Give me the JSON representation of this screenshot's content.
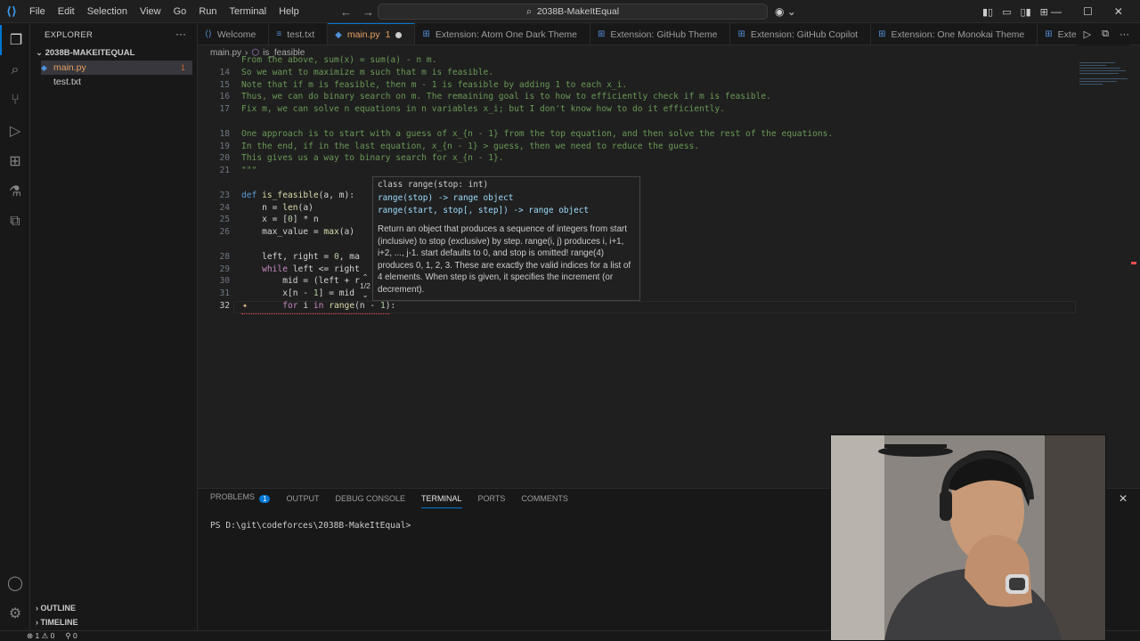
{
  "titlebar": {
    "menu": [
      "File",
      "Edit",
      "Selection",
      "View",
      "Go",
      "Run",
      "Terminal",
      "Help"
    ],
    "search_text": "2038B-MakeItEqual"
  },
  "sidebar": {
    "title": "EXPLORER",
    "folder": "2038B-MAKEITEQUAL",
    "files": [
      {
        "name": "main.py",
        "count": "1"
      },
      {
        "name": "test.txt",
        "count": ""
      }
    ],
    "outline": "OUTLINE",
    "timeline": "TIMELINE"
  },
  "tabs": [
    {
      "label": "Welcome",
      "icon": "vscode-icon"
    },
    {
      "label": "test.txt",
      "icon": "file-icon"
    },
    {
      "label": "main.py",
      "count": "1",
      "icon": "python-icon"
    },
    {
      "label": "Extension: Atom One Dark Theme",
      "icon": "extension-icon"
    },
    {
      "label": "Extension: GitHub Theme",
      "icon": "extension-icon"
    },
    {
      "label": "Extension: GitHub Copilot",
      "icon": "extension-icon"
    },
    {
      "label": "Extension: One Monokai Theme",
      "icon": "extension-icon"
    },
    {
      "label": "Extensio",
      "icon": "extension-icon"
    }
  ],
  "breadcrumb": {
    "file": "main.py",
    "symbol": "is_feasible"
  },
  "editor": {
    "line_numbers": [
      "",
      "14",
      "15",
      "16",
      "17",
      "",
      "18",
      "19",
      "20",
      "21",
      "",
      "23",
      "24",
      "25",
      "26",
      "",
      "28",
      "29",
      "30",
      "31",
      "32"
    ],
    "current_line": "32",
    "lines": [
      "From the above, sum(x) = sum(a) - n m.",
      "So we want to maximize m such that m is feasible.",
      "Note that if m is feasible, then m - 1 is feasible by adding 1 to each x_i.",
      "Thus, we can do binary search on m. The remaining goal is to how to efficiently check if m is feasible.",
      "Fix m, we can solve n equations in n variables x_i; but I don't know how to do it efficiently.",
      "",
      "One approach is to start with a guess of x_{n - 1} from the top equation, and then solve the rest of the equations.",
      "In the end, if in the last equation, x_{n - 1} > guess, then we need to reduce the guess.",
      "This gives us a way to binary search for x_{n - 1}.",
      "\"\"\"",
      "",
      "def is_feasible(a, m):",
      "    n = len(a)",
      "    x = [0] * n",
      "    max_value = max(a)",
      "",
      "    left, right = 0, ma",
      "    while left <= right",
      "        mid = (left + r",
      "        x[n - 1] = mid",
      "        for i in range(n - 1):"
    ]
  },
  "hover": {
    "sig1": "class range(stop: int)",
    "sig2": "range(stop) -> range object",
    "sig3": "range(start, stop[, step]) -> range object",
    "doc": "Return an object that produces a sequence of integers from start (inclusive) to stop (exclusive) by step. range(i, j) produces i, i+1, i+2, ..., j-1. start defaults to 0, and stop is omitted! range(4) produces 0, 1, 2, 3. These are exactly the valid indices for a list of 4 elements. When step is given, it specifies the increment (or decrement).",
    "overload": "1/2"
  },
  "panel": {
    "tabs": [
      "PROBLEMS",
      "OUTPUT",
      "DEBUG CONSOLE",
      "TERMINAL",
      "PORTS",
      "COMMENTS"
    ],
    "problems_count": "1",
    "active_tab": "TERMINAL",
    "terminal_text": "PS D:\\git\\codeforces\\2038B-MakeItEqual>"
  },
  "statusbar": {
    "errors": "1",
    "warnings": "0",
    "ports": "0"
  },
  "colors": {
    "accent": "#0078d4",
    "background": "#1f1f1f",
    "sidebar": "#181818",
    "modified_tab": "#e8a060"
  }
}
